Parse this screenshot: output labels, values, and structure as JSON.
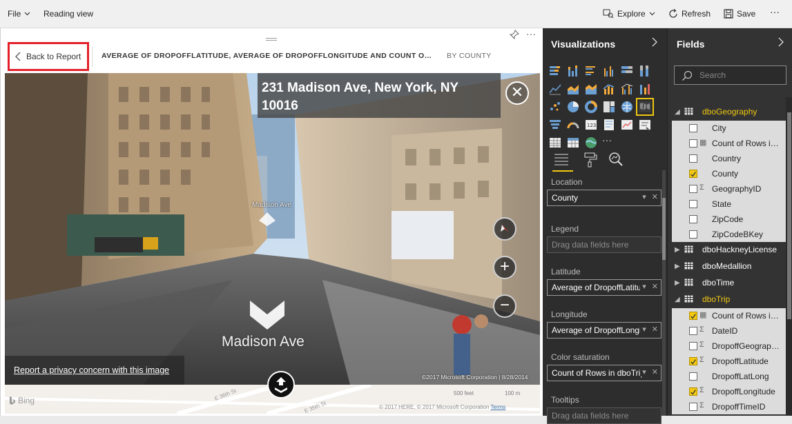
{
  "toolbar": {
    "file_label": "File",
    "reading_view_label": "Reading view",
    "explore_label": "Explore",
    "refresh_label": "Refresh",
    "save_label": "Save",
    "more_label": "···"
  },
  "canvas": {
    "back_label": "Back to Report",
    "header_title": "AVERAGE OF DROPOFFLATITUDE, AVERAGE OF DROPOFFLONGITUDE AND COUNT OF ROWS IN DBOTRIP",
    "header_sub": "BY COUNTY",
    "more_label": "···"
  },
  "streetview": {
    "address": "231 Madison Ave, New York, NY 10016",
    "street_name": "Madison Ave",
    "street_name_small": "Madison Ave",
    "privacy_label": "Report a privacy concern with this image",
    "copyright": "©2017 Microsoft Corporation | 8/28/2014",
    "close_label": "✕",
    "zoom_in_label": "+",
    "zoom_out_label": "−"
  },
  "map": {
    "bing_label": "Bing",
    "copyright": "© 2017 HERE, © 2017 Microsoft Corporation",
    "terms_label": "Terms",
    "scale_feet": "500 feet",
    "scale_m": "100 m",
    "street1": "E 36th St",
    "street2": "E 35th St"
  },
  "visualizations": {
    "title": "Visualizations",
    "more_label": "···",
    "wells": [
      {
        "label": "Location",
        "value": "County",
        "empty": false
      },
      {
        "label": "Legend",
        "value": "Drag data fields here",
        "empty": true
      },
      {
        "label": "Latitude",
        "value": "Average of DropoffLatitude",
        "empty": false
      },
      {
        "label": "Longitude",
        "value": "Average of DropoffLongitude",
        "empty": false
      },
      {
        "label": "Color saturation",
        "value": "Count of Rows in dboTrip",
        "empty": false
      },
      {
        "label": "Tooltips",
        "value": "Drag data fields here",
        "empty": true
      }
    ]
  },
  "fields": {
    "title": "Fields",
    "search_placeholder": "Search",
    "rows": [
      {
        "kind": "table",
        "name": "dboGeography",
        "expanded": true,
        "selected": true
      },
      {
        "kind": "field",
        "name": "City",
        "type": "",
        "checked": false
      },
      {
        "kind": "field",
        "name": "Count of Rows in dboGeography",
        "type": "calc",
        "checked": false
      },
      {
        "kind": "field",
        "name": "Country",
        "type": "",
        "checked": false
      },
      {
        "kind": "field",
        "name": "County",
        "type": "",
        "checked": true
      },
      {
        "kind": "field",
        "name": "GeographyID",
        "type": "sigma",
        "checked": false
      },
      {
        "kind": "field",
        "name": "State",
        "type": "",
        "checked": false
      },
      {
        "kind": "field",
        "name": "ZipCode",
        "type": "",
        "checked": false
      },
      {
        "kind": "field",
        "name": "ZipCodeBKey",
        "type": "",
        "checked": false
      },
      {
        "kind": "table",
        "name": "dboHackneyLicense",
        "expanded": false,
        "selected": false
      },
      {
        "kind": "table",
        "name": "dboMedallion",
        "expanded": false,
        "selected": false
      },
      {
        "kind": "table",
        "name": "dboTime",
        "expanded": false,
        "selected": false
      },
      {
        "kind": "table",
        "name": "dboTrip",
        "expanded": true,
        "selected": true
      },
      {
        "kind": "field",
        "name": "Count of Rows in dboTrip",
        "type": "calc",
        "checked": true
      },
      {
        "kind": "field",
        "name": "DateID",
        "type": "sigma",
        "checked": false
      },
      {
        "kind": "field",
        "name": "DropoffGeographyID",
        "type": "sigma",
        "checked": false
      },
      {
        "kind": "field",
        "name": "DropoffLatitude",
        "type": "sigma",
        "checked": true
      },
      {
        "kind": "field",
        "name": "DropoffLatLong",
        "type": "",
        "checked": false
      },
      {
        "kind": "field",
        "name": "DropoffLongitude",
        "type": "sigma",
        "checked": true
      },
      {
        "kind": "field",
        "name": "DropoffTimeID",
        "type": "sigma",
        "checked": false
      }
    ]
  },
  "colors": {
    "accent": "#f2c811",
    "highlight_border": "#e3202a",
    "pane_dark": "#2d2d2d"
  }
}
